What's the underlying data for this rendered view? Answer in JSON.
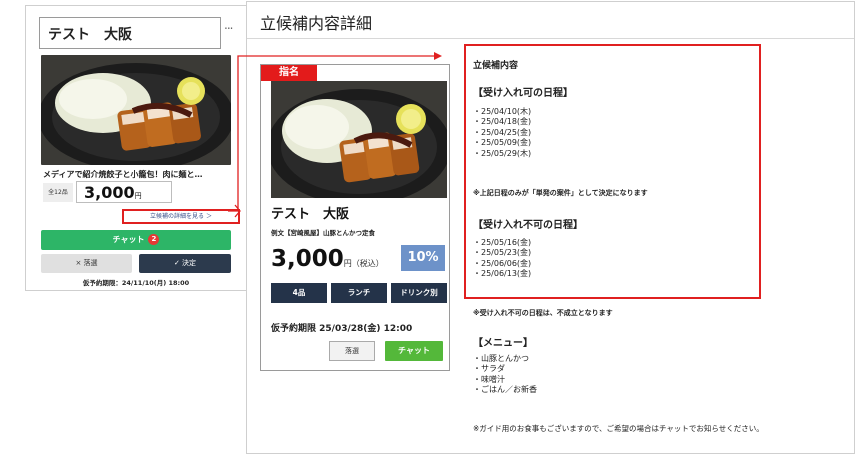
{
  "small_card": {
    "title": "テスト　大阪",
    "more": "...",
    "description": "メディアで紹介焼餃子と小籠包！肉に麺と…",
    "item_count": "全12品",
    "price": "3,000",
    "price_unit": "円",
    "detail_link": "立候補の詳細を見る ＞",
    "chat_label": "チャット",
    "chat_badge": "2",
    "drop_label": "× 落選",
    "decide_label": "✓ 決定",
    "deadline": "仮予約期限：24/11/10(月) 18:00"
  },
  "panel": {
    "title": "立候補内容詳細"
  },
  "big_card": {
    "tag": "指名",
    "title": "テスト　大阪",
    "description": "例文【宮崎風屋】山豚とんかつ定食",
    "price": "3,000",
    "price_unit": "円（税込）",
    "discount": "10%",
    "tags": [
      "4品",
      "ランチ",
      "ドリンク別"
    ],
    "deadline": "仮予約期限 25/03/28(金) 12:00",
    "drop_label": "落選",
    "chat_label": "チャット"
  },
  "details": {
    "heading": "立候補内容",
    "accept_heading": "【受け入れ可の日程】",
    "accept_dates": [
      "・25/04/10(木)",
      "・25/04/18(金)",
      "・25/04/25(金)",
      "・25/05/09(金)",
      "・25/05/29(木)"
    ],
    "accept_note": "※上記日程のみが「単発の案件」として決定になります",
    "reject_heading": "【受け入れ不可の日程】",
    "reject_dates": [
      "・25/05/16(金)",
      "・25/05/23(金)",
      "・25/06/06(金)",
      "・25/06/13(金)"
    ],
    "reject_note": "※受け入れ不可の日程は、不成立となります",
    "menu_heading": "【メニュー】",
    "menu_items": [
      "・山豚とんかつ",
      "・サラダ",
      "・味噌汁",
      "・ごはん／お新香"
    ],
    "footer_note": "※ガイド用のお食事もございますので、ご希望の場合はチャットでお知らせください。"
  },
  "colors": {
    "accent_red": "#e02020",
    "chat_green": "#2db567",
    "navy": "#243349",
    "discount_blue": "#6d92c9"
  },
  "icons": [
    "badge-icon",
    "arrow-icon"
  ]
}
